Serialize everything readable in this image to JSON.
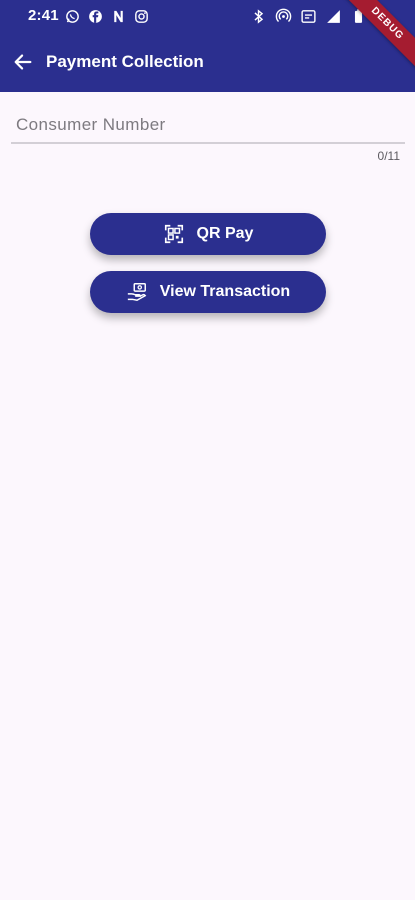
{
  "status_bar": {
    "time": "2:41",
    "left_icons": [
      "whatsapp-icon",
      "facebook-icon",
      "n-app-icon",
      "instagram-icon"
    ],
    "right_icons": [
      "bluetooth-icon",
      "hotspot-icon",
      "data-icon",
      "signal-icon",
      "battery-icon"
    ],
    "debug_label": "DEBUG"
  },
  "appbar": {
    "title": "Payment Collection",
    "back_icon": "arrow-left-icon"
  },
  "form": {
    "consumer_number": {
      "placeholder": "Consumer Number",
      "value": "",
      "counter": "0/11"
    }
  },
  "actions": {
    "qr_pay": {
      "label": "QR Pay",
      "icon": "qr-scan-icon"
    },
    "view_transaction": {
      "label": "View Transaction",
      "icon": "hand-money-icon"
    }
  },
  "colors": {
    "primary": "#2b2f8f",
    "background": "#fcf7fd",
    "debug_ribbon": "#a51c30"
  }
}
